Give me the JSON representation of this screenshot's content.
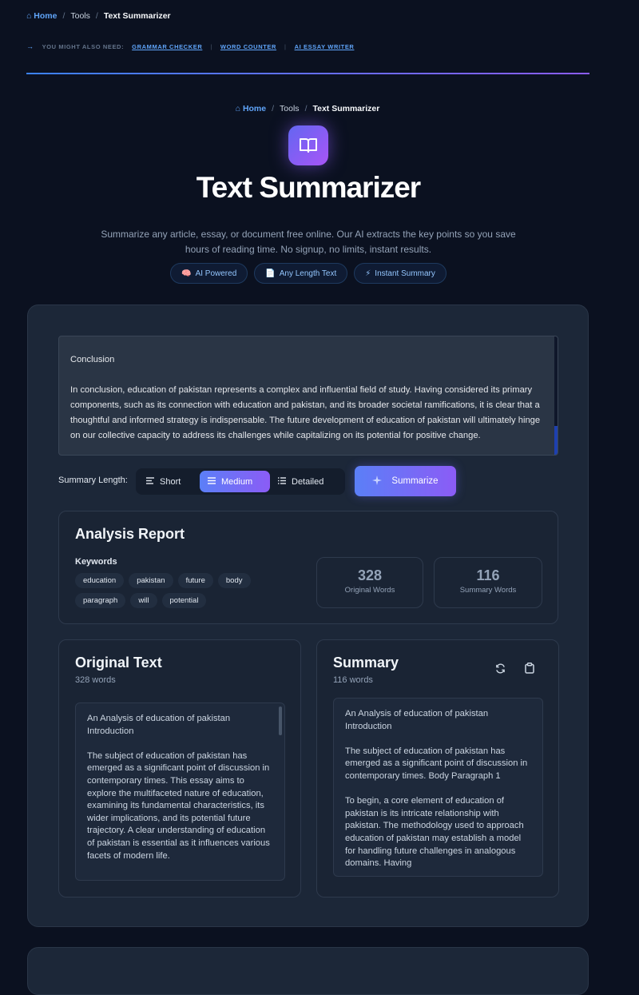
{
  "breadcrumb": {
    "home": "Home",
    "sep": "/",
    "tools": "Tools",
    "current": "Text Summarizer"
  },
  "also_need": {
    "lead": "YOU MIGHT ALSO NEED:",
    "links": [
      "GRAMMAR CHECKER",
      "WORD COUNTER",
      "AI ESSAY WRITER"
    ],
    "divider": "|"
  },
  "hero": {
    "icon": "book-icon",
    "title": "Text Summarizer",
    "subtitle": "Summarize any article, essay, or document free online. Our AI extracts the key points so you save hours of reading time. No signup, no limits, instant results.",
    "badges": [
      {
        "icon": "brain-icon",
        "glyph": "🧠",
        "label": "AI Powered"
      },
      {
        "icon": "document-icon",
        "glyph": "📄",
        "label": "Any Length Text"
      },
      {
        "icon": "lightning-icon",
        "glyph": "⚡",
        "label": "Instant Summary"
      }
    ]
  },
  "input": {
    "text": "Conclusion\n\nIn conclusion, education of pakistan represents a complex and influential field of study. Having considered its primary components, such as its connection with education and pakistan, and its broader societal ramifications, it is clear that a thoughtful and informed strategy is indispensable. The future development of education of pakistan will ultimately hinge on our collective capacity to address its challenges while capitalizing on its potential for positive change."
  },
  "controls": {
    "length_label": "Summary Length:",
    "options": [
      "Short",
      "Medium",
      "Detailed"
    ],
    "selected": "Medium",
    "summarize_label": "Summarize"
  },
  "analysis": {
    "title": "Analysis Report",
    "keywords_label": "Keywords",
    "keywords": [
      "education",
      "pakistan",
      "future",
      "body",
      "paragraph",
      "will",
      "potential"
    ],
    "original_words": "328",
    "original_words_label": "Original Words",
    "summary_words": "116",
    "summary_words_label": "Summary Words"
  },
  "original_panel": {
    "title": "Original Text",
    "count": "328 words",
    "text": "An Analysis of education of pakistan\nIntroduction\n\nThe subject of education of pakistan has emerged as a significant point of discussion in contemporary times. This essay aims to explore the multifaceted nature of education, examining its fundamental characteristics, its wider implications, and its potential future trajectory. A clear understanding of education of pakistan is essential as it influences various facets of modern life."
  },
  "summary_panel": {
    "title": "Summary",
    "count": "116 words",
    "text": "An Analysis of education of pakistan\nIntroduction\n\nThe subject of education of pakistan has emerged as a significant point of discussion in contemporary times. Body Paragraph 1\n\nTo begin, a core element of education of pakistan is its intricate relationship with pakistan. The methodology used to approach education of pakistan may establish a model for handling future challenges in analogous domains. Having"
  },
  "colors": {
    "accent_blue": "#5b7ff7",
    "accent_purple": "#8b5cf6",
    "background": "#0b1120",
    "card": "#1c2738"
  }
}
